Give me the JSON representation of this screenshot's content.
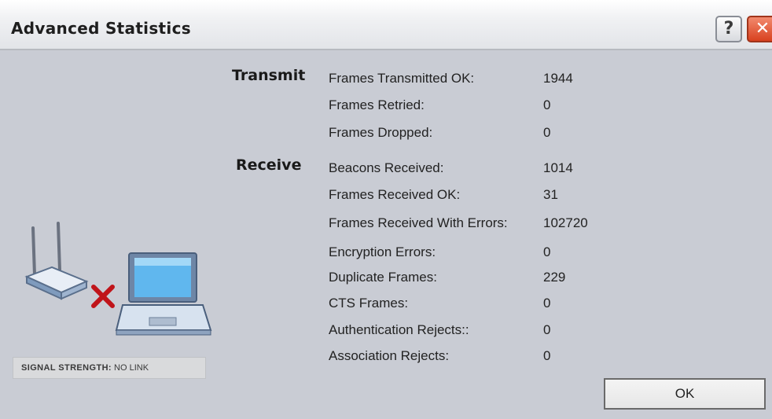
{
  "window": {
    "title": "Advanced Statistics",
    "help_glyph": "?",
    "close_glyph": "✕"
  },
  "signal": {
    "label": "SIGNAL STRENGTH:",
    "value": "NO LINK"
  },
  "transmit": {
    "heading": "Transmit",
    "rows": [
      {
        "label": "Frames Transmitted OK:",
        "value": "1944"
      },
      {
        "label": "Frames Retried:",
        "value": "0"
      },
      {
        "label": "Frames Dropped:",
        "value": "0"
      }
    ]
  },
  "receive": {
    "heading": "Receive",
    "rows": [
      {
        "label": "Beacons Received:",
        "value": "1014"
      },
      {
        "label": "Frames Received OK:",
        "value": "31"
      },
      {
        "label": "Frames Received With Errors:",
        "value": "102720"
      },
      {
        "label": "Encryption Errors:",
        "value": "0"
      },
      {
        "label": "Duplicate Frames:",
        "value": "229"
      },
      {
        "label": "CTS Frames:",
        "value": "0"
      },
      {
        "label": "Authentication Rejects::",
        "value": "0"
      },
      {
        "label": "Association Rejects:",
        "value": "0"
      }
    ]
  },
  "buttons": {
    "ok": "OK"
  },
  "icons": [
    "router-icon",
    "red-x-icon",
    "laptop-icon",
    "help-icon",
    "close-icon"
  ],
  "colors": {
    "background": "#c9ccd4",
    "close_button": "#d8411f",
    "disconnect_x": "#c0141a"
  }
}
